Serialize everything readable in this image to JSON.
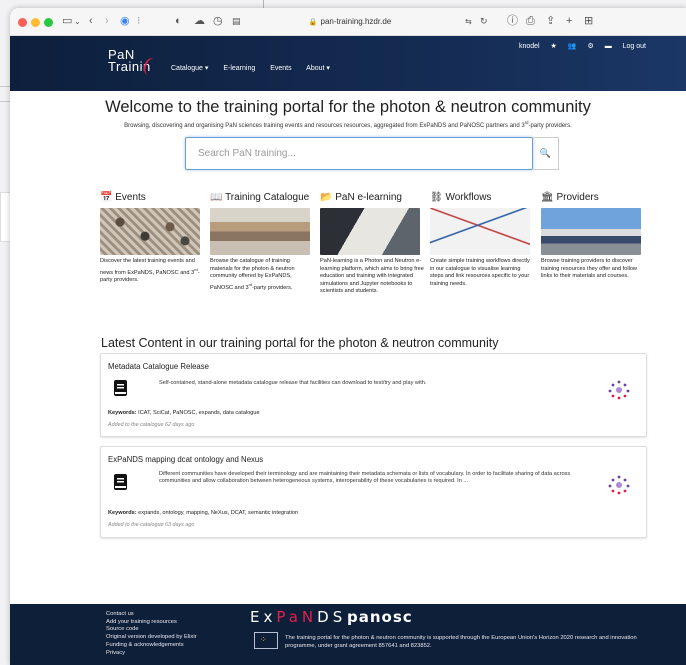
{
  "browser": {
    "url": "pan-training.hzdr.de",
    "icons": [
      "sidebar-icon",
      "back-icon",
      "forward-icon",
      "shield-icon",
      "privacy-icon",
      "cloud-icon",
      "clock-icon",
      "reader-icon",
      "translate-icon",
      "reload-icon",
      "info-icon",
      "print-icon",
      "share-icon",
      "new-tab-icon",
      "tabs-overview-icon"
    ]
  },
  "navbar": {
    "logo_line1": "PaN",
    "logo_line2": "Trainin",
    "links": [
      "Catalogue ▾",
      "E-learning",
      "Events",
      "About ▾"
    ],
    "user": "knodel",
    "logout": "Log out",
    "user_icons": [
      "star-icon",
      "users-icon",
      "gear-icon",
      "inbox-icon"
    ]
  },
  "hero": {
    "title": "Welcome to the training portal for the photon & neutron community",
    "subtitle": "Browsing, discovering and organising PaN sciences training events and resources resources, aggregated from ExPaNDS and PaNOSC partners and 3rd-party providers."
  },
  "search": {
    "placeholder": "Search PaN training...",
    "button": "🔍"
  },
  "cards": [
    {
      "icon": "📅",
      "title": "Events",
      "text": "Discover the latest training events and news from ExPaNDS, PaNOSC and 3rd-party providers.",
      "img": "crowd"
    },
    {
      "icon": "📖",
      "title": "Training Catalogue",
      "text": "Browse the catalogue of training materials for the photon & neutron community offered by ExPaNDS, PaNOSC and 3rd-party providers.",
      "img": "library"
    },
    {
      "icon": "📂",
      "title": "PaN e-learning",
      "text": "PaN-learning is a Photon and Neutron e-learning platform, which aims to bring free education and training with integrated simulations and Jupyter notebooks to scientists and students.",
      "img": "laptop"
    },
    {
      "icon": "⛓",
      "title": "Workflows",
      "text": "Create simple training workflows directly in our catalogue to visualise learning steps and link resources specific to your training needs.",
      "img": "whiteboard"
    },
    {
      "icon": "🏛",
      "title": "Providers",
      "text": "Browse training providers to discover training resources they offer and follow links to their materials and courses.",
      "img": "building"
    }
  ],
  "latest": {
    "heading": "Latest Content in our training portal for the photon & neutron community",
    "keywords_label": "Keywords:",
    "items": [
      {
        "title": "Metadata Catalogue Release",
        "description": "Self-contained, stand-alone metadata catalogue release that facilities can download to test/try and play with.",
        "keywords": "ICAT, SciCat, PaNOSC, expands, data catalogue",
        "added": "Added to the catalogue 62 days ago"
      },
      {
        "title": "ExPaNDS mapping dcat ontology and Nexus",
        "description": "Different communities have developed their terminology and are maintaining their metadata schemata or lists of vocabulary. In order to facilitate sharing of data across communities and allow collaboration between heterogeneous systems, interoperability of these vocabularies is required. In ...",
        "keywords": "expands, ontology, mapping, NeXus, DCAT, semantic integration",
        "added": "Added to the catalogue 63 days ago"
      }
    ]
  },
  "footer": {
    "links": [
      "Contact us",
      "Add your training resources",
      "Source code",
      "Original version developed by Elixir",
      "Funding & acknowledgements",
      "Privacy"
    ],
    "expands_logo": "ExPaNDS",
    "panosc_logo": "panosc",
    "funding": "The training portal for the photon & neutron community is supported through the European Union's Horizon 2020 research and innovation programme, under grant agreement 857641 and 823852."
  },
  "colors": {
    "navy": "#0d1f3c",
    "accent": "#e0204a",
    "search_border": "#6a9ed6"
  }
}
